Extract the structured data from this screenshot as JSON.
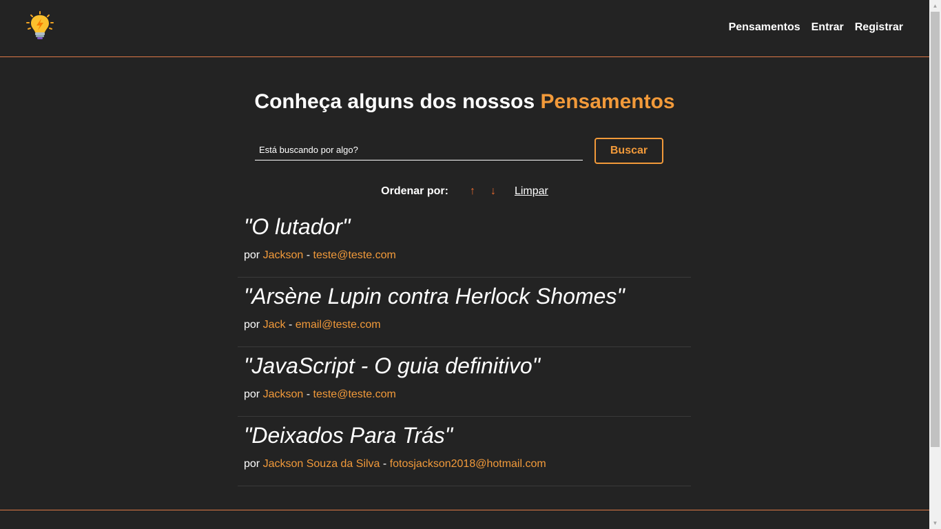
{
  "nav": {
    "logo_icon": "lightbulb-icon",
    "links": [
      "Pensamentos",
      "Entrar",
      "Registrar"
    ]
  },
  "main": {
    "title_prefix": "Conheça alguns dos nossos",
    "title_accent": "Pensamentos"
  },
  "search": {
    "placeholder": "Está buscando por algo?",
    "value": "",
    "button_label": "Buscar"
  },
  "order": {
    "label": "Ordenar por:",
    "asc_icon": "↑",
    "desc_icon": "↓",
    "clear_label": "Limpar"
  },
  "thoughts": [
    {
      "title": "\"O lutador\"",
      "prefix": "por",
      "author": "Jackson",
      "separator": "-",
      "email": "teste@teste.com"
    },
    {
      "title": "\"Arsène Lupin contra Herlock Shomes\"",
      "prefix": "por",
      "author": "Jack",
      "separator": "-",
      "email": "email@teste.com"
    },
    {
      "title": "\"JavaScript - O guia definitivo\"",
      "prefix": "por",
      "author": "Jackson",
      "separator": "-",
      "email": "teste@teste.com"
    },
    {
      "title": "\"Deixados Para Trás\"",
      "prefix": "por",
      "author": "Jackson Souza da Silva",
      "separator": "-",
      "email": "fotosjackson2018@hotmail.com"
    }
  ],
  "colors": {
    "background": "#232323",
    "accent": "#f29a3a",
    "divider": "#e07a47",
    "arrow": "#e86a2e"
  }
}
